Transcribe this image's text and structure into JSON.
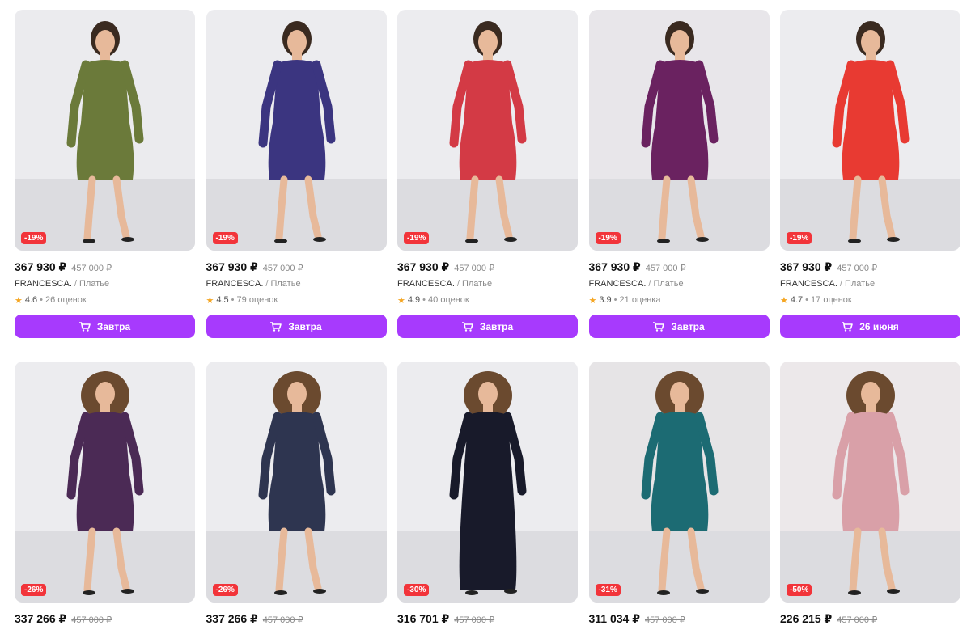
{
  "products": [
    {
      "discount": "-19%",
      "price": "367 930 ₽",
      "old_price": "457 000 ₽",
      "brand": "FRANCESCA.",
      "category": "Платье",
      "rating": "4.6",
      "reviews": "26 оценок",
      "button": "Завтра",
      "dress_color": "#6b7a3a",
      "bg": "#ebebee"
    },
    {
      "discount": "-19%",
      "price": "367 930 ₽",
      "old_price": "457 000 ₽",
      "brand": "FRANCESCA.",
      "category": "Платье",
      "rating": "4.5",
      "reviews": "79 оценок",
      "button": "Завтра",
      "dress_color": "#3b3580",
      "bg": "#ececef"
    },
    {
      "discount": "-19%",
      "price": "367 930 ₽",
      "old_price": "457 000 ₽",
      "brand": "FRANCESCA.",
      "category": "Платье",
      "rating": "4.9",
      "reviews": "40 оценок",
      "button": "Завтра",
      "dress_color": "#d33a45",
      "bg": "#ececef"
    },
    {
      "discount": "-19%",
      "price": "367 930 ₽",
      "old_price": "457 000 ₽",
      "brand": "FRANCESCA.",
      "category": "Платье",
      "rating": "3.9",
      "reviews": "21 оценка",
      "button": "Завтра",
      "dress_color": "#6a2260",
      "bg": "#e8e6ea"
    },
    {
      "discount": "-19%",
      "price": "367 930 ₽",
      "old_price": "457 000 ₽",
      "brand": "FRANCESCA.",
      "category": "Платье",
      "rating": "4.7",
      "reviews": "17 оценок",
      "button": "26 июня",
      "dress_color": "#e83a32",
      "bg": "#ececef"
    },
    {
      "discount": "-26%",
      "price": "337 266 ₽",
      "old_price": "457 000 ₽",
      "dress_color": "#4b2a55",
      "bg": "#ececef"
    },
    {
      "discount": "-26%",
      "price": "337 266 ₽",
      "old_price": "457 000 ₽",
      "dress_color": "#2e3550",
      "bg": "#ececef"
    },
    {
      "discount": "-30%",
      "price": "316 701 ₽",
      "old_price": "457 000 ₽",
      "dress_color": "#181a2a",
      "bg": "#ececef"
    },
    {
      "discount": "-31%",
      "price": "311 034 ₽",
      "old_price": "457 000 ₽",
      "dress_color": "#1c6b73",
      "bg": "#e6e4e6"
    },
    {
      "discount": "-50%",
      "price": "226 215 ₽",
      "old_price": "457 000 ₽",
      "dress_color": "#d9a0a8",
      "bg": "#ece8ea"
    }
  ],
  "icons": {
    "cart": "cart-icon",
    "star": "star-icon"
  },
  "colors": {
    "accent": "#a73afd",
    "badge": "#f2343a",
    "star": "#f5a623"
  }
}
